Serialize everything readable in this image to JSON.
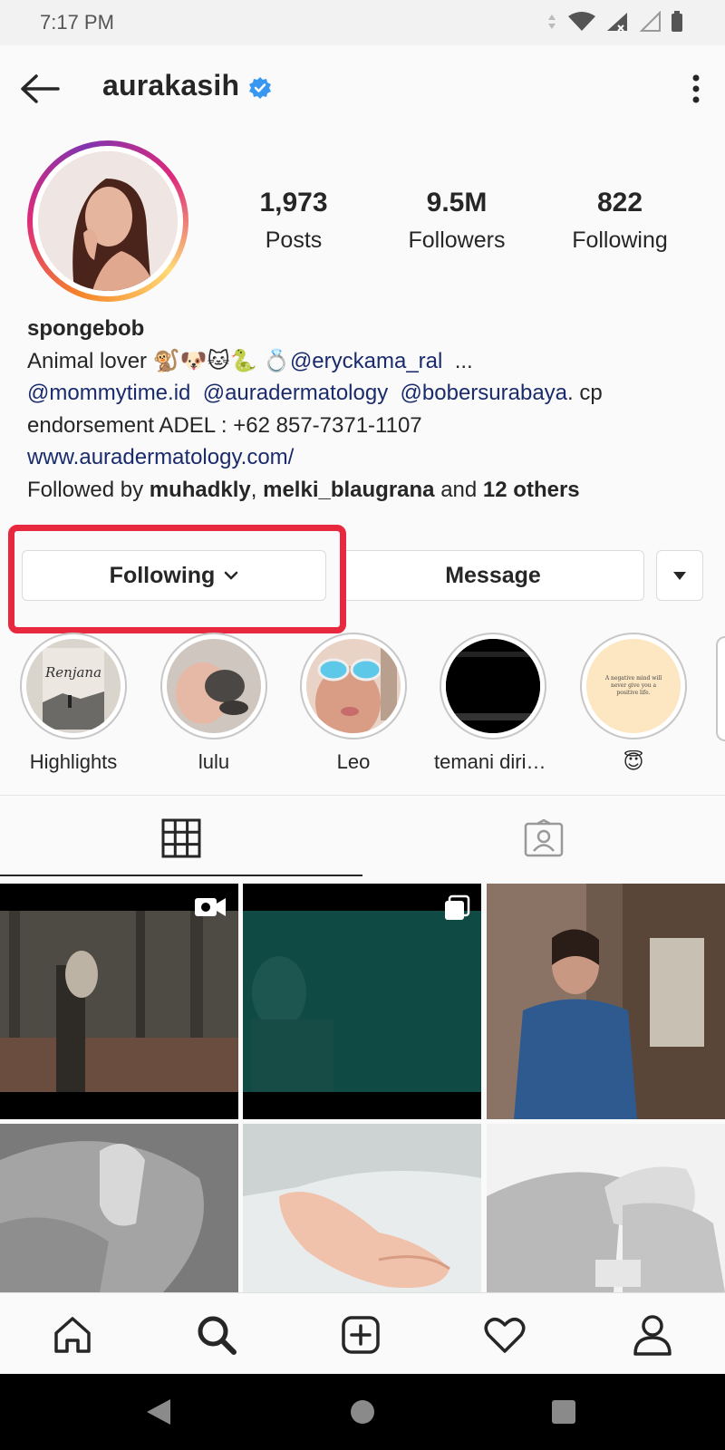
{
  "status": {
    "time": "7:17 PM"
  },
  "header": {
    "username": "aurakasih"
  },
  "stats": [
    {
      "value": "1,973",
      "label": "Posts"
    },
    {
      "value": "9.5M",
      "label": "Followers"
    },
    {
      "value": "822",
      "label": "Following"
    }
  ],
  "bio": {
    "name": "spongebob",
    "line1_text": "Animal lover 🐒🐶🐱🐍 💍",
    "line1_link": "@eryckama_ral",
    "line1_tail": "...",
    "line2_link1": "@mommytime.id",
    "line2_link2": "@auradermatology",
    "line2_link3": "@bobersurabaya",
    "line2_tail": ". cp",
    "line3": "endorsement ADEL : +62 857-7371-1107",
    "website": "www.auradermatology.com/",
    "followed_by_prefix": "Followed by",
    "followed_by_user1": "muhadkly",
    "followed_by_user2": "melki_blaugrana",
    "followed_by_and": "and",
    "followed_by_others": "12 others"
  },
  "buttons": {
    "following": "Following",
    "message": "Message"
  },
  "highlights": [
    {
      "label": "Highlights"
    },
    {
      "label": "lulu"
    },
    {
      "label": "Leo"
    },
    {
      "label": "temani dirik…"
    },
    {
      "label": "😇"
    }
  ],
  "highlight_quote": "A negative mind will never give you a positive life.",
  "book_title": "Renjana",
  "colors": {
    "accent_red": "#e8283f",
    "link": "#1a2b6d",
    "verified": "#3897f0"
  }
}
